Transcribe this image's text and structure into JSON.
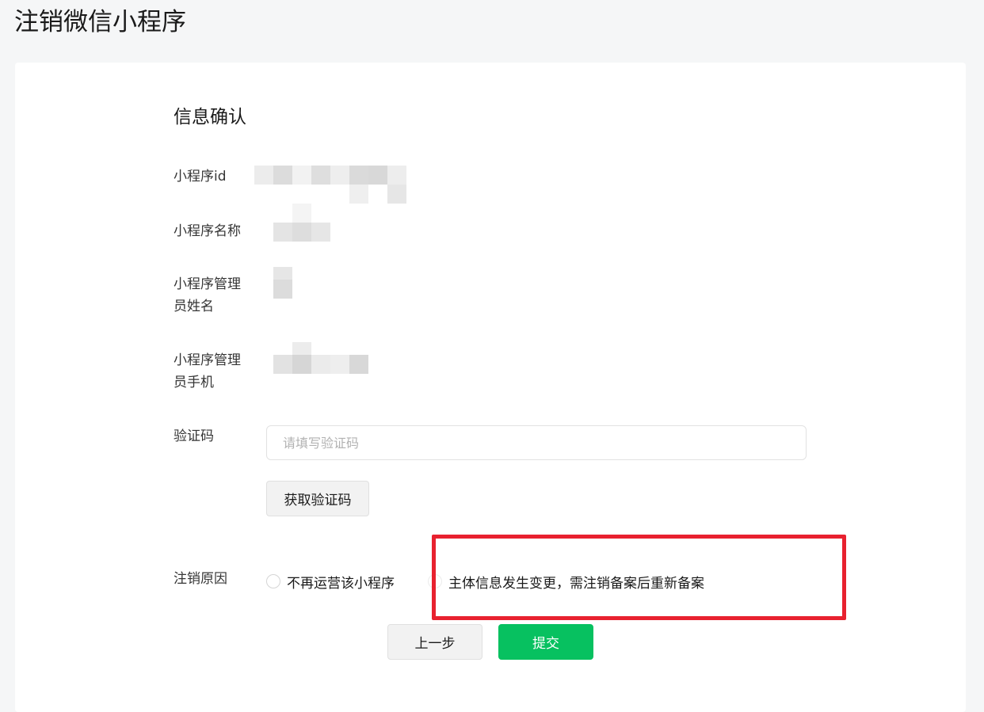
{
  "page": {
    "title": "注销微信小程序"
  },
  "form": {
    "section_title": "信息确认",
    "fields": {
      "app_id_label": "小程序id",
      "app_name_label": "小程序名称",
      "admin_name_label": "小程序管理员姓名",
      "admin_phone_label": "小程序管理员手机",
      "verify_code_label": "验证码",
      "reason_label": "注销原因"
    },
    "verify_code": {
      "value": "",
      "placeholder": "请填写验证码",
      "get_code_button": "获取验证码"
    },
    "reason_options": [
      {
        "label": "不再运营该小程序",
        "selected": false
      },
      {
        "label": "主体信息发生变更，需注销备案后重新备案",
        "selected": false
      }
    ],
    "buttons": {
      "back": "上一步",
      "submit": "提交"
    }
  },
  "colors": {
    "primary": "#07c160",
    "highlight": "#e8212f",
    "background": "#f5f6f7"
  }
}
